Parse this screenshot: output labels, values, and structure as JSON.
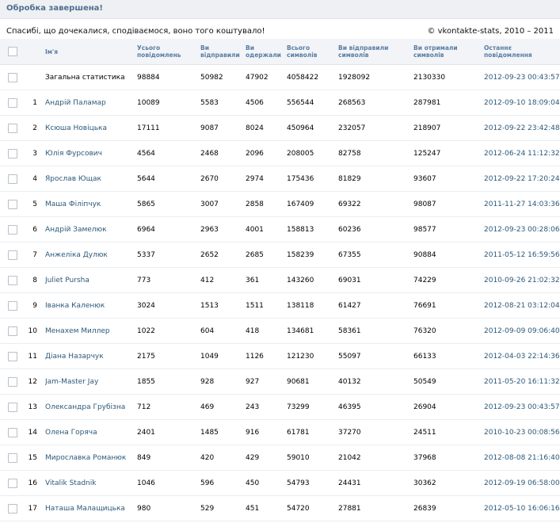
{
  "header": {
    "title": "Обробка завершена!"
  },
  "message": {
    "text": "Спасибі, що дочекалися, сподіваємося, воно того коштувало!",
    "copyright_symbol": "©",
    "link": "vkontakte-stats",
    "years": ", 2010 – 2011"
  },
  "table": {
    "columns": [
      {
        "line1": "Ім'я",
        "line2": ""
      },
      {
        "line1": "Усього",
        "line2": "повідомлень"
      },
      {
        "line1": "Ви",
        "line2": "відправили"
      },
      {
        "line1": "Ви",
        "line2": "одержали"
      },
      {
        "line1": "Всього",
        "line2": "символів"
      },
      {
        "line1": "Ви відправили",
        "line2": "символів"
      },
      {
        "line1": "Ви отримали",
        "line2": "символів"
      },
      {
        "line1": "Останнє",
        "line2": "повідомлення"
      }
    ],
    "rows": [
      {
        "num": "",
        "name": "Загальна статистика",
        "total": "98884",
        "sent": "50982",
        "received": "47902",
        "chars_total": "4058422",
        "chars_sent": "1928092",
        "chars_received": "2130330",
        "last": "2012-09-23 00:43:57"
      },
      {
        "num": "1",
        "name": "Андрій Паламар",
        "total": "10089",
        "sent": "5583",
        "received": "4506",
        "chars_total": "556544",
        "chars_sent": "268563",
        "chars_received": "287981",
        "last": "2012-09-10 18:09:04"
      },
      {
        "num": "2",
        "name": "Ксюша Новіцька",
        "total": "17111",
        "sent": "9087",
        "received": "8024",
        "chars_total": "450964",
        "chars_sent": "232057",
        "chars_received": "218907",
        "last": "2012-09-22 23:42:48"
      },
      {
        "num": "3",
        "name": "Юлія Фурсович",
        "total": "4564",
        "sent": "2468",
        "received": "2096",
        "chars_total": "208005",
        "chars_sent": "82758",
        "chars_received": "125247",
        "last": "2012-06-24 11:12:32"
      },
      {
        "num": "4",
        "name": "Ярослав Ющак",
        "total": "5644",
        "sent": "2670",
        "received": "2974",
        "chars_total": "175436",
        "chars_sent": "81829",
        "chars_received": "93607",
        "last": "2012-09-22 17:20:24"
      },
      {
        "num": "5",
        "name": "Маша Філіпчук",
        "total": "5865",
        "sent": "3007",
        "received": "2858",
        "chars_total": "167409",
        "chars_sent": "69322",
        "chars_received": "98087",
        "last": "2011-11-27 14:03:36"
      },
      {
        "num": "6",
        "name": "Андрій Замелюк",
        "total": "6964",
        "sent": "2963",
        "received": "4001",
        "chars_total": "158813",
        "chars_sent": "60236",
        "chars_received": "98577",
        "last": "2012-09-23 00:28:06"
      },
      {
        "num": "7",
        "name": "Анжеліка Дулюк",
        "total": "5337",
        "sent": "2652",
        "received": "2685",
        "chars_total": "158239",
        "chars_sent": "67355",
        "chars_received": "90884",
        "last": "2011-05-12 16:59:56"
      },
      {
        "num": "8",
        "name": "Juliet Pursha",
        "total": "773",
        "sent": "412",
        "received": "361",
        "chars_total": "143260",
        "chars_sent": "69031",
        "chars_received": "74229",
        "last": "2010-09-26 21:02:32"
      },
      {
        "num": "9",
        "name": "Іванка Каленюк",
        "total": "3024",
        "sent": "1513",
        "received": "1511",
        "chars_total": "138118",
        "chars_sent": "61427",
        "chars_received": "76691",
        "last": "2012-08-21 03:12:04"
      },
      {
        "num": "10",
        "name": "Менахем Миллер",
        "total": "1022",
        "sent": "604",
        "received": "418",
        "chars_total": "134681",
        "chars_sent": "58361",
        "chars_received": "76320",
        "last": "2012-09-09 09:06:40"
      },
      {
        "num": "11",
        "name": "Діана Назарчук",
        "total": "2175",
        "sent": "1049",
        "received": "1126",
        "chars_total": "121230",
        "chars_sent": "55097",
        "chars_received": "66133",
        "last": "2012-04-03 22:14:36"
      },
      {
        "num": "12",
        "name": "Jam-Master Jay",
        "total": "1855",
        "sent": "928",
        "received": "927",
        "chars_total": "90681",
        "chars_sent": "40132",
        "chars_received": "50549",
        "last": "2011-05-20 16:11:32"
      },
      {
        "num": "13",
        "name": "Олександра Грубізна",
        "total": "712",
        "sent": "469",
        "received": "243",
        "chars_total": "73299",
        "chars_sent": "46395",
        "chars_received": "26904",
        "last": "2012-09-23 00:43:57"
      },
      {
        "num": "14",
        "name": "Олена Горяча",
        "total": "2401",
        "sent": "1485",
        "received": "916",
        "chars_total": "61781",
        "chars_sent": "37270",
        "chars_received": "24511",
        "last": "2010-10-23 00:08:56"
      },
      {
        "num": "15",
        "name": "Мирославка Романюк",
        "total": "849",
        "sent": "420",
        "received": "429",
        "chars_total": "59010",
        "chars_sent": "21042",
        "chars_received": "37968",
        "last": "2012-08-08 21:16:40"
      },
      {
        "num": "16",
        "name": "Vitalik Stadnik",
        "total": "1046",
        "sent": "596",
        "received": "450",
        "chars_total": "54793",
        "chars_sent": "24431",
        "chars_received": "30362",
        "last": "2012-09-19 06:58:00"
      },
      {
        "num": "17",
        "name": "Наташа Малащицька",
        "total": "980",
        "sent": "529",
        "received": "451",
        "chars_total": "54720",
        "chars_sent": "27881",
        "chars_received": "26839",
        "last": "2012-05-10 16:06:16"
      }
    ]
  },
  "colors": {
    "link": "#2b587a",
    "header_text": "#5a7da3",
    "title_text": "#4f6f90",
    "topbar_bg": "#eef0f3"
  }
}
